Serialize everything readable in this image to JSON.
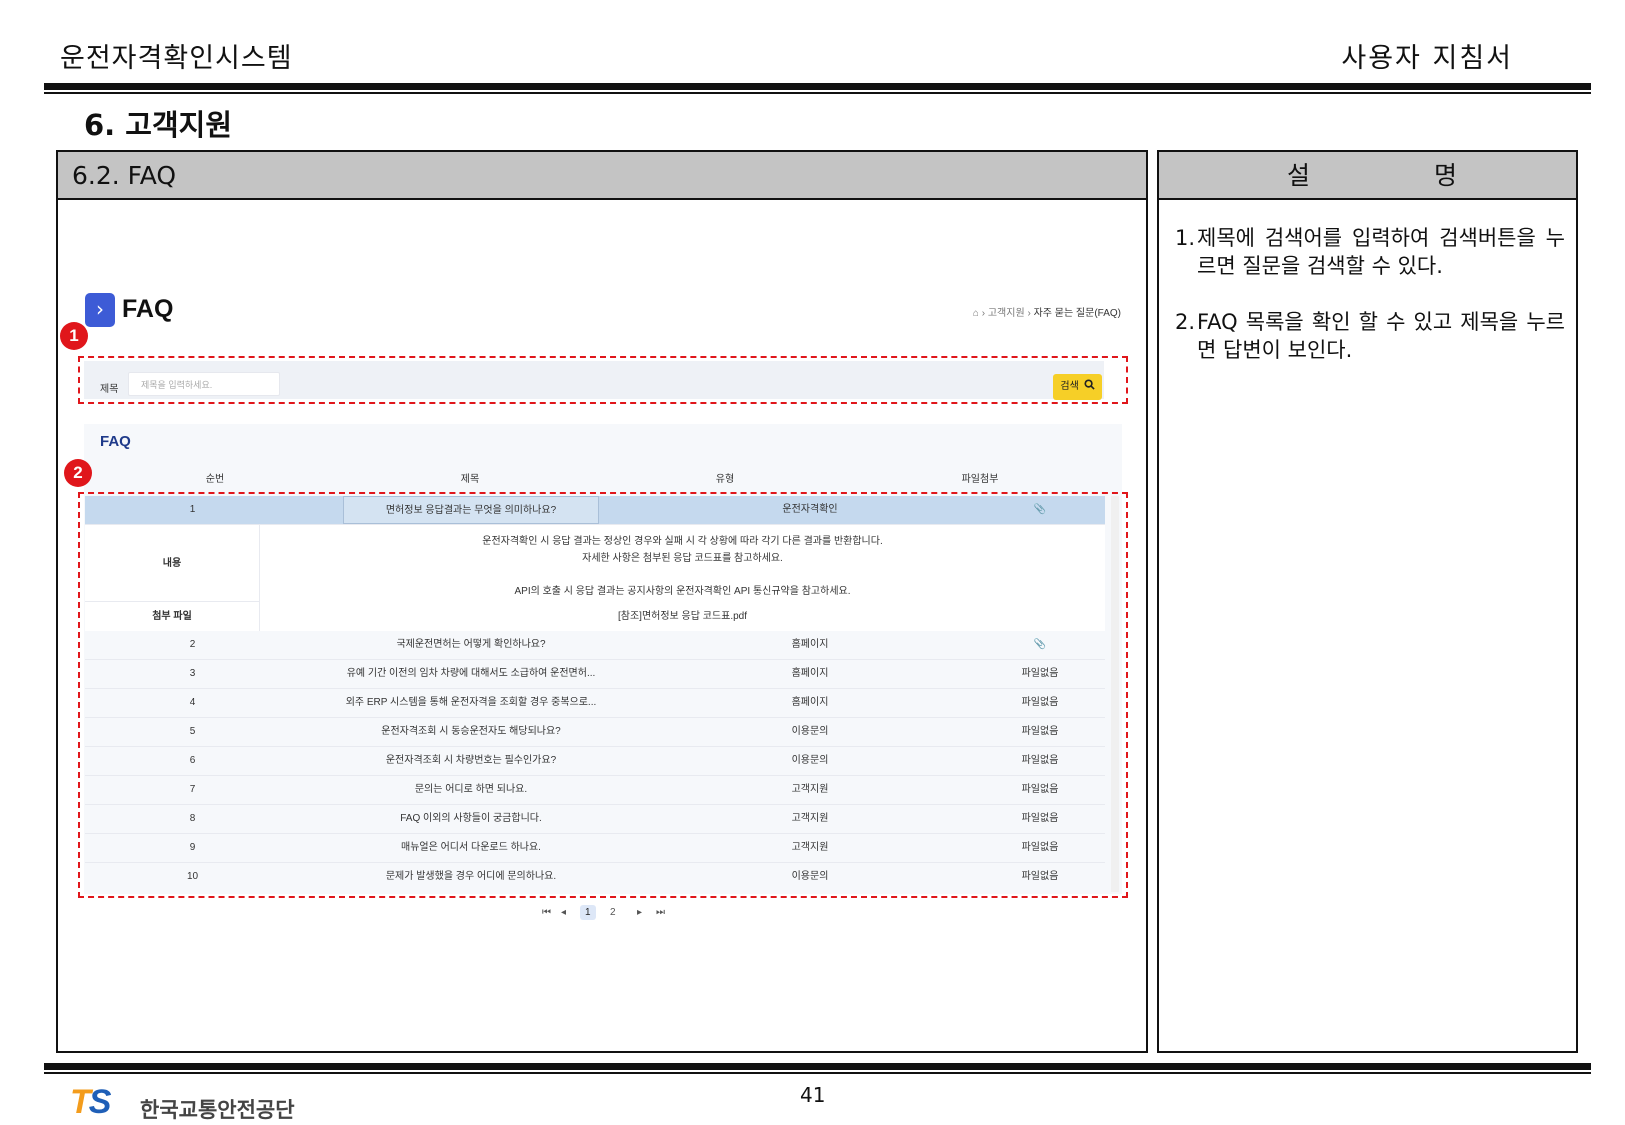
{
  "header": {
    "system_title": "운전자격확인시스템",
    "doc_type": "사용자 지침서"
  },
  "section": {
    "heading": "6. 고객지원",
    "subsection": "6.2. FAQ"
  },
  "desc_panel": {
    "head_left": "설",
    "head_right": "명",
    "items": [
      {
        "num": "1.",
        "text": "제목에 검색어를 입력하여 검색버튼을 누르면 질문을 검색할 수 있다."
      },
      {
        "num": "2.",
        "text": "FAQ 목록을 확인 할 수 있고 제목을 누르면 답변이 보인다."
      }
    ]
  },
  "screen": {
    "badge": "›",
    "title": "FAQ",
    "breadcrumb": {
      "home": "⌂",
      "sep": "›",
      "parent": "고객지원",
      "current": "자주 묻는 질문(FAQ)"
    },
    "markers": [
      "1",
      "2"
    ],
    "search": {
      "label": "제목",
      "placeholder": "제목을 입력하세요.",
      "button": "검색"
    },
    "list": {
      "title": "FAQ",
      "columns": [
        "순번",
        "제목",
        "유형",
        "파일첨부"
      ],
      "rows": [
        {
          "no": "1",
          "title": "면허정보 응답결과는 무엇을 의미하나요?",
          "type": "운전자격확인",
          "file": "📎"
        },
        {
          "no": "2",
          "title": "국제운전면허는 어떻게 확인하나요?",
          "type": "홈페이지",
          "file": "📎"
        },
        {
          "no": "3",
          "title": "유예 기간 이전의 임차 차량에 대해서도 소급하여 운전면허...",
          "type": "홈페이지",
          "file": "파일없음"
        },
        {
          "no": "4",
          "title": "외주 ERP 시스템을 통해 운전자격을 조회할 경우 중복으로...",
          "type": "홈페이지",
          "file": "파일없음"
        },
        {
          "no": "5",
          "title": "운전자격조회 시 동승운전자도 해당되나요?",
          "type": "이용문의",
          "file": "파일없음"
        },
        {
          "no": "6",
          "title": "운전자격조회 시 차량번호는 필수인가요?",
          "type": "이용문의",
          "file": "파일없음"
        },
        {
          "no": "7",
          "title": "문의는 어디로 하면 되나요.",
          "type": "고객지원",
          "file": "파일없음"
        },
        {
          "no": "8",
          "title": "FAQ 이외의 사항들이 궁금합니다.",
          "type": "고객지원",
          "file": "파일없음"
        },
        {
          "no": "9",
          "title": "매뉴얼은 어디서 다운로드 하나요.",
          "type": "고객지원",
          "file": "파일없음"
        },
        {
          "no": "10",
          "title": "문제가 발생했을 경우 어디에 문의하나요.",
          "type": "이용문의",
          "file": "파일없음"
        }
      ],
      "detail": {
        "content_label": "내용",
        "content_lines": [
          "운전자격확인 시 응답 결과는 정상인 경우와 실패 시 각 상황에 따라 각기 다른 결과를 반환합니다.",
          "자세한 사항은 첨부된 응답 코드표를 참고하세요.",
          "API의 호출 시 응답 결과는 공지사항의 운전자격확인 API 통신규약을 참고하세요."
        ],
        "attach_label": "첨부 파일",
        "attach_file": "[참조]면허정보 응답 코드표.pdf"
      }
    },
    "pager": {
      "first": "⏮",
      "prev": "◂",
      "pages": [
        "1",
        "2"
      ],
      "next": "▸",
      "last": "⏭"
    }
  },
  "footer": {
    "page_number": "41",
    "logo_mark": "TS",
    "org_name": "한국교통안전공단"
  },
  "colors": {
    "accent_red": "#e0161b",
    "badge_blue": "#3d5bd6",
    "search_yellow": "#f6cf27",
    "selected_row": "#c5d9ee",
    "panel_head": "#c4c4c4"
  }
}
